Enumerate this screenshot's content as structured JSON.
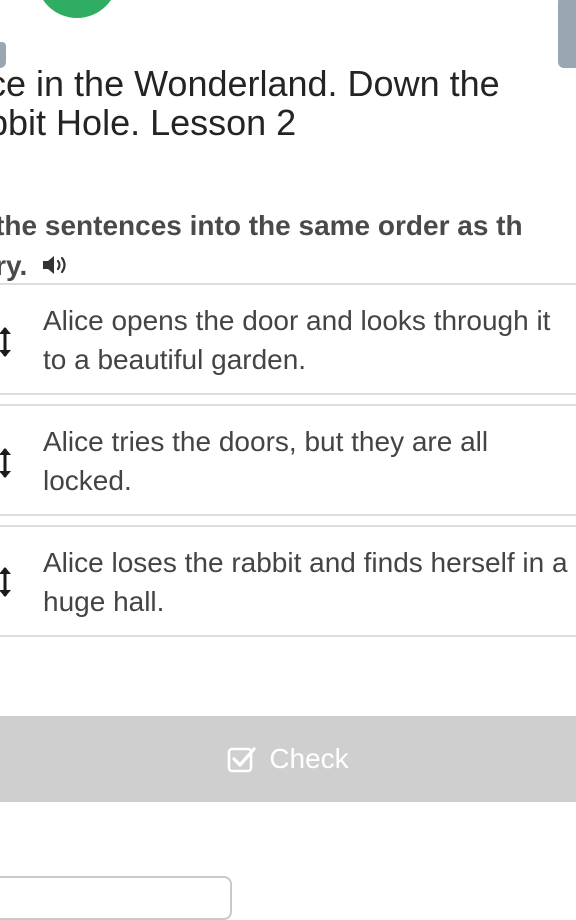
{
  "lesson": {
    "title_lines": [
      "ce in the Wonderland. Down the",
      "bbit Hole. Lesson 2"
    ]
  },
  "task": {
    "instruction_lines": [
      "t the sentences into the same order as th",
      "ory."
    ],
    "speaker_icon": "speaker-icon"
  },
  "sentences": [
    {
      "text": "Alice opens the door and looks through it to a beautiful garden.",
      "handle_icon": "drag-handle-icon"
    },
    {
      "text": "Alice tries the doors, but they are all locked.",
      "handle_icon": "drag-handle-icon"
    },
    {
      "text": "Alice loses the rabbit and finds herself in a huge hall.",
      "handle_icon": "drag-handle-icon"
    }
  ],
  "check_button": {
    "label": "Check",
    "icon": "checkbox-icon"
  },
  "colors": {
    "avatar": "#2fae63",
    "check_bar": "#cfcfcf",
    "tabs": "#9aa7b3"
  }
}
